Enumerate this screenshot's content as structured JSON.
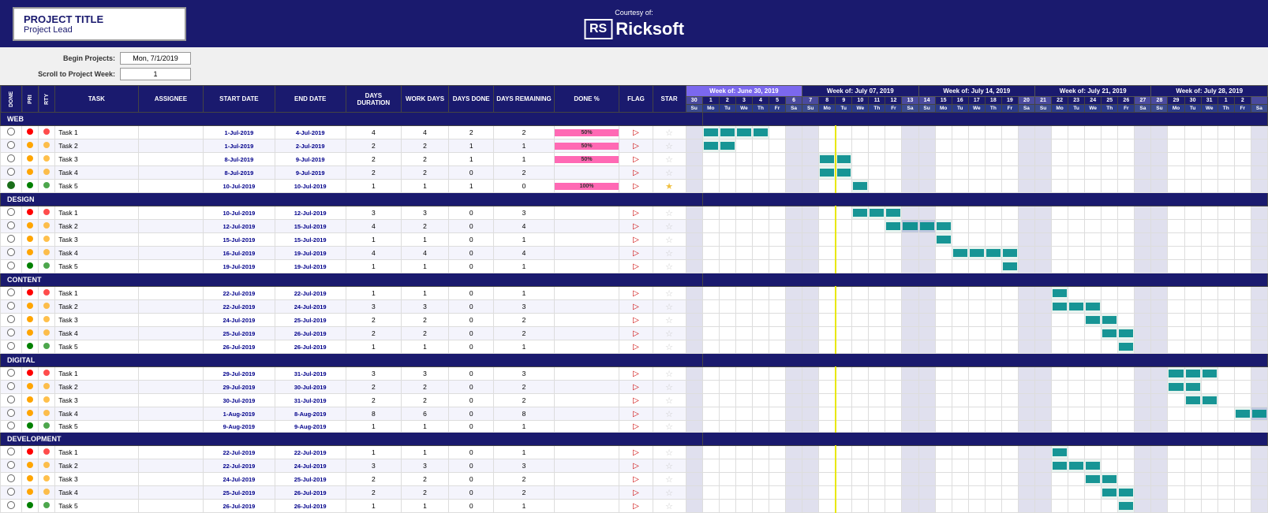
{
  "header": {
    "project_title": "PROJECT TITLE",
    "project_lead": "Project Lead",
    "courtesy_label": "Courtesy of:",
    "logo_rs": "RS",
    "logo_name": "Ricksoft"
  },
  "settings": {
    "begin_label": "Begin Projects:",
    "begin_value": "Mon, 7/1/2019",
    "scroll_label": "Scroll to Project Week:",
    "scroll_value": "1"
  },
  "columns": {
    "done": "DONE",
    "priority": "PRI",
    "rty": "RTY",
    "task": "TASK",
    "assignee": "ASSIGNEE",
    "start_date": "START DATE",
    "end_date": "END DATE",
    "days_duration": "DAYS DURATION",
    "work_days": "WORK DAYS",
    "days_done": "DAYS DONE",
    "days_remaining": "DAYS REMAINING",
    "done_pct": "DONE %",
    "flag": "FLAG",
    "star": "STAR"
  },
  "weeks": [
    {
      "label": "Week of: June 30, 2019",
      "color": "purple",
      "days": [
        "30",
        "1",
        "2",
        "3",
        "4",
        "5",
        "6"
      ],
      "day_names": [
        "Su",
        "Mo",
        "Tu",
        "We",
        "Th",
        "Fr",
        "Sa"
      ]
    },
    {
      "label": "Week of: July 07, 2019",
      "color": "blue",
      "days": [
        "7",
        "8",
        "9",
        "10",
        "11",
        "12",
        "13"
      ],
      "day_names": [
        "Su",
        "Mo",
        "Tu",
        "We",
        "Th",
        "Fr",
        "Sa"
      ]
    },
    {
      "label": "Week of: July 14, 2019",
      "color": "blue",
      "days": [
        "14",
        "15",
        "16",
        "17",
        "18",
        "19",
        "20"
      ],
      "day_names": [
        "Su",
        "Mo",
        "Tu",
        "We",
        "Th",
        "Fr",
        "Sa"
      ]
    },
    {
      "label": "Week of: July 21, 2019",
      "color": "blue",
      "days": [
        "21",
        "22",
        "23",
        "24",
        "25",
        "26",
        "27"
      ],
      "day_names": [
        "Su",
        "Mo",
        "Tu",
        "We",
        "Th",
        "Fr",
        "Sa"
      ]
    },
    {
      "label": "Week of: July 28, 2019",
      "color": "blue",
      "days": [
        "28",
        "29",
        "30",
        "31",
        "1",
        "2",
        ""
      ],
      "day_names": [
        "Su",
        "Mo",
        "Tu",
        "We",
        "Th",
        "Fr",
        "Sa"
      ]
    }
  ],
  "sections": [
    {
      "name": "WEB",
      "tasks": [
        {
          "done": "empty",
          "priority": "red",
          "task": "Task 1",
          "start": "1-Jul-2019",
          "end": "4-Jul-2019",
          "days": 4,
          "work": 4,
          "done_days": 2,
          "remaining": 2,
          "pct": "50%",
          "flag": true,
          "star": false,
          "bars": [
            1,
            2,
            3,
            4
          ]
        },
        {
          "done": "empty",
          "priority": "orange",
          "task": "Task 2",
          "start": "1-Jul-2019",
          "end": "2-Jul-2019",
          "days": 2,
          "work": 2,
          "done_days": 1,
          "remaining": 1,
          "pct": "50%",
          "flag": true,
          "star": false,
          "bars": [
            1,
            2
          ]
        },
        {
          "done": "empty",
          "priority": "orange",
          "task": "Task 3",
          "start": "8-Jul-2019",
          "end": "9-Jul-2019",
          "days": 2,
          "work": 2,
          "done_days": 1,
          "remaining": 1,
          "pct": "50%",
          "flag": true,
          "star": false,
          "bars": [
            8,
            9
          ]
        },
        {
          "done": "empty",
          "priority": "orange",
          "task": "Task 4",
          "start": "8-Jul-2019",
          "end": "9-Jul-2019",
          "days": 2,
          "work": 2,
          "done_days": 0,
          "remaining": 2,
          "pct": "",
          "flag": true,
          "star": false,
          "bars": [
            8,
            9
          ]
        },
        {
          "done": "done",
          "priority": "green",
          "task": "Task 5",
          "start": "10-Jul-2019",
          "end": "10-Jul-2019",
          "days": 1,
          "work": 1,
          "done_days": 1,
          "remaining": 0,
          "pct": "100%",
          "flag": true,
          "star": true,
          "bars": [
            10
          ]
        }
      ]
    },
    {
      "name": "DESIGN",
      "tasks": [
        {
          "done": "empty",
          "priority": "red",
          "task": "Task 1",
          "start": "10-Jul-2019",
          "end": "12-Jul-2019",
          "days": 3,
          "work": 3,
          "done_days": 0,
          "remaining": 3,
          "pct": "",
          "flag": true,
          "star": false,
          "bars": [
            10,
            11,
            12
          ]
        },
        {
          "done": "empty",
          "priority": "orange",
          "task": "Task 2",
          "start": "12-Jul-2019",
          "end": "15-Jul-2019",
          "days": 4,
          "work": 2,
          "done_days": 0,
          "remaining": 4,
          "pct": "",
          "flag": true,
          "star": false,
          "bars": [
            12,
            13,
            14,
            15
          ]
        },
        {
          "done": "empty",
          "priority": "orange",
          "task": "Task 3",
          "start": "15-Jul-2019",
          "end": "15-Jul-2019",
          "days": 1,
          "work": 1,
          "done_days": 0,
          "remaining": 1,
          "pct": "",
          "flag": true,
          "star": false,
          "bars": [
            15
          ]
        },
        {
          "done": "empty",
          "priority": "orange",
          "task": "Task 4",
          "start": "16-Jul-2019",
          "end": "19-Jul-2019",
          "days": 4,
          "work": 4,
          "done_days": 0,
          "remaining": 4,
          "pct": "",
          "flag": true,
          "star": false,
          "bars": [
            16,
            17,
            18,
            19
          ]
        },
        {
          "done": "empty",
          "priority": "green",
          "task": "Task 5",
          "start": "19-Jul-2019",
          "end": "19-Jul-2019",
          "days": 1,
          "work": 1,
          "done_days": 0,
          "remaining": 1,
          "pct": "",
          "flag": true,
          "star": false,
          "bars": [
            19
          ]
        }
      ]
    },
    {
      "name": "CONTENT",
      "tasks": [
        {
          "done": "empty",
          "priority": "red",
          "task": "Task 1",
          "start": "22-Jul-2019",
          "end": "22-Jul-2019",
          "days": 1,
          "work": 1,
          "done_days": 0,
          "remaining": 1,
          "pct": "",
          "flag": true,
          "star": false,
          "bars": [
            22
          ]
        },
        {
          "done": "empty",
          "priority": "orange",
          "task": "Task 2",
          "start": "22-Jul-2019",
          "end": "24-Jul-2019",
          "days": 3,
          "work": 3,
          "done_days": 0,
          "remaining": 3,
          "pct": "",
          "flag": true,
          "star": false,
          "bars": [
            22,
            23,
            24
          ]
        },
        {
          "done": "empty",
          "priority": "orange",
          "task": "Task 3",
          "start": "24-Jul-2019",
          "end": "25-Jul-2019",
          "days": 2,
          "work": 2,
          "done_days": 0,
          "remaining": 2,
          "pct": "",
          "flag": true,
          "star": false,
          "bars": [
            24,
            25
          ]
        },
        {
          "done": "empty",
          "priority": "orange",
          "task": "Task 4",
          "start": "25-Jul-2019",
          "end": "26-Jul-2019",
          "days": 2,
          "work": 2,
          "done_days": 0,
          "remaining": 2,
          "pct": "",
          "flag": true,
          "star": false,
          "bars": [
            25,
            26
          ]
        },
        {
          "done": "empty",
          "priority": "green",
          "task": "Task 5",
          "start": "26-Jul-2019",
          "end": "26-Jul-2019",
          "days": 1,
          "work": 1,
          "done_days": 0,
          "remaining": 1,
          "pct": "",
          "flag": true,
          "star": false,
          "bars": [
            26
          ]
        }
      ]
    },
    {
      "name": "DIGITAL",
      "tasks": [
        {
          "done": "empty",
          "priority": "red",
          "task": "Task 1",
          "start": "29-Jul-2019",
          "end": "31-Jul-2019",
          "days": 3,
          "work": 3,
          "done_days": 0,
          "remaining": 3,
          "pct": "",
          "flag": true,
          "star": false,
          "bars": [
            29,
            30,
            31
          ]
        },
        {
          "done": "empty",
          "priority": "orange",
          "task": "Task 2",
          "start": "29-Jul-2019",
          "end": "30-Jul-2019",
          "days": 2,
          "work": 2,
          "done_days": 0,
          "remaining": 2,
          "pct": "",
          "flag": true,
          "star": false,
          "bars": [
            29,
            30
          ]
        },
        {
          "done": "empty",
          "priority": "orange",
          "task": "Task 3",
          "start": "30-Jul-2019",
          "end": "31-Jul-2019",
          "days": 2,
          "work": 2,
          "done_days": 0,
          "remaining": 2,
          "pct": "",
          "flag": true,
          "star": false,
          "bars": [
            30,
            31
          ]
        },
        {
          "done": "empty",
          "priority": "orange",
          "task": "Task 4",
          "start": "1-Aug-2019",
          "end": "8-Aug-2019",
          "days": 8,
          "work": 6,
          "done_days": 0,
          "remaining": 8,
          "pct": "",
          "flag": true,
          "star": false,
          "bars": []
        },
        {
          "done": "empty",
          "priority": "green",
          "task": "Task 5",
          "start": "9-Aug-2019",
          "end": "9-Aug-2019",
          "days": 1,
          "work": 1,
          "done_days": 0,
          "remaining": 1,
          "pct": "",
          "flag": true,
          "star": false,
          "bars": []
        }
      ]
    },
    {
      "name": "DEVELOPMENT",
      "tasks": [
        {
          "done": "empty",
          "priority": "red",
          "task": "Task 1",
          "start": "22-Jul-2019",
          "end": "22-Jul-2019",
          "days": 1,
          "work": 1,
          "done_days": 0,
          "remaining": 1,
          "pct": "",
          "flag": true,
          "star": false,
          "bars": [
            22
          ]
        },
        {
          "done": "empty",
          "priority": "orange",
          "task": "Task 2",
          "start": "22-Jul-2019",
          "end": "24-Jul-2019",
          "days": 3,
          "work": 3,
          "done_days": 0,
          "remaining": 3,
          "pct": "",
          "flag": true,
          "star": false,
          "bars": [
            22,
            23,
            24
          ]
        },
        {
          "done": "empty",
          "priority": "orange",
          "task": "Task 3",
          "start": "24-Jul-2019",
          "end": "25-Jul-2019",
          "days": 2,
          "work": 2,
          "done_days": 0,
          "remaining": 2,
          "pct": "",
          "flag": true,
          "star": false,
          "bars": [
            24,
            25
          ]
        },
        {
          "done": "empty",
          "priority": "orange",
          "task": "Task 4",
          "start": "25-Jul-2019",
          "end": "26-Jul-2019",
          "days": 2,
          "work": 2,
          "done_days": 0,
          "remaining": 2,
          "pct": "",
          "flag": true,
          "star": false,
          "bars": [
            25,
            26
          ]
        },
        {
          "done": "empty",
          "priority": "green",
          "task": "Task 5",
          "start": "26-Jul-2019",
          "end": "26-Jul-2019",
          "days": 1,
          "work": 1,
          "done_days": 0,
          "remaining": 1,
          "pct": "",
          "flag": true,
          "star": false,
          "bars": [
            26
          ]
        }
      ]
    }
  ]
}
